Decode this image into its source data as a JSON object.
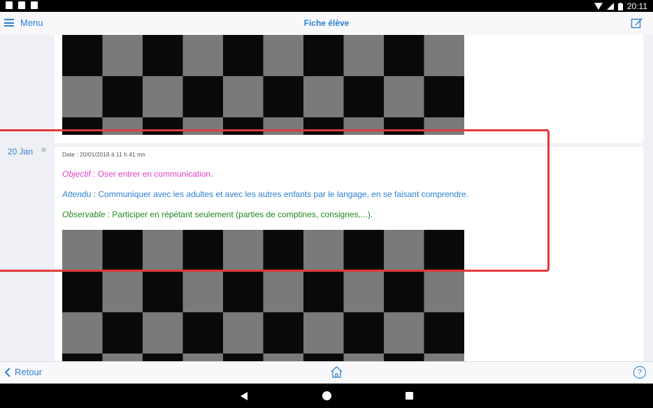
{
  "statusbar": {
    "time": "20:11"
  },
  "topbar": {
    "menu_label": "Menu",
    "title": "Fiche élève"
  },
  "timeline": {
    "date_label": "20 Jan",
    "entry": {
      "meta": "Date : 20/01/2018 à 11 h 41 mn",
      "objectif_label": "Objectif",
      "objectif_text": " : Oser entrer en communication.",
      "attendu_label": "Attendu",
      "attendu_text": " : Communiquer avec les adultes et avec les autres enfants par le langage, en se faisant comprendre.",
      "observable_label": "Observable",
      "observable_text": " : Participer en répétant seulement (parties de comptines, consignes,...)."
    }
  },
  "bottombar": {
    "back_label": "Retour",
    "help_label": "?"
  },
  "colors": {
    "accent": "#2a7fd4",
    "objectif": "#e040c8",
    "observable": "#1a8a1a",
    "highlight": "#e0393a"
  }
}
